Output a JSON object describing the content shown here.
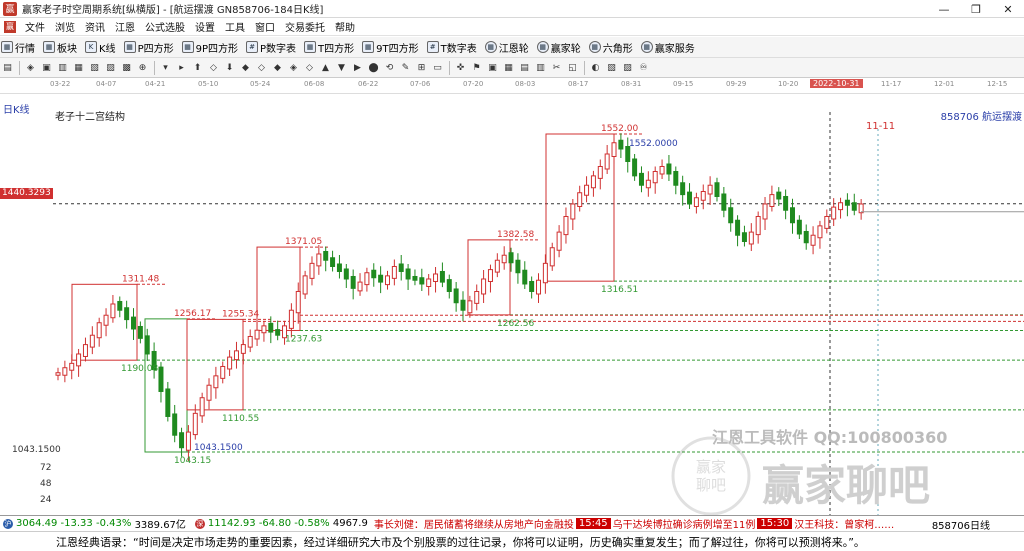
{
  "window": {
    "title": "赢家老子时空周期系统[纵横版] - [航运摆渡  GN858706-184日K线]",
    "controls": [
      "—",
      "❐",
      "✕"
    ]
  },
  "menu": {
    "items": [
      "文件",
      "浏览",
      "资讯",
      "江恩",
      "公式选股",
      "设置",
      "工具",
      "窗口",
      "交易委托",
      "帮助"
    ],
    "mdi_controls": [
      "—",
      "❐",
      "✕"
    ]
  },
  "toolbar1": {
    "items": [
      {
        "label": "行情",
        "icon": "market-grid-icon"
      },
      {
        "label": "板块",
        "icon": "sector-icon"
      },
      {
        "label": "K线",
        "icon": "kline-icon"
      },
      {
        "label": "P四方形",
        "icon": "square-icon"
      },
      {
        "label": "9P四方形",
        "icon": "square-icon"
      },
      {
        "label": "P数字表",
        "icon": "table-icon"
      },
      {
        "label": "T四方形",
        "icon": "square-icon"
      },
      {
        "label": "9T四方形",
        "icon": "square-icon"
      },
      {
        "label": "T数字表",
        "icon": "table-icon"
      },
      {
        "label": "江恩轮",
        "icon": "wheel-icon"
      },
      {
        "label": "赢家轮",
        "icon": "wheel-icon"
      },
      {
        "label": "六角形",
        "icon": "hexagon-icon"
      },
      {
        "label": "赢家服务",
        "icon": "service-icon"
      }
    ]
  },
  "toolbar2": {
    "glyphs": [
      "▤",
      "◈",
      "▣",
      "▥",
      "▦",
      "▧",
      "▨",
      "▩",
      "⊕",
      "▾",
      "▸",
      "⬆",
      "◇",
      "⬇",
      "◆",
      "◇",
      "◆",
      "◈",
      "◇",
      "▲",
      "▼",
      "▶",
      "⬤",
      "⟲",
      "✎",
      "⊞",
      "▭",
      "✜",
      "⚑",
      "▣",
      "▦",
      "▤",
      "▥",
      "✂",
      "◱",
      "◐",
      "▧",
      "▨",
      "♾"
    ]
  },
  "datebar": {
    "labels": [
      "03-22",
      "04-07",
      "04-21",
      "05-10",
      "05-24",
      "06-08",
      "06-22",
      "07-06",
      "07-20",
      "08-03",
      "08-17",
      "08-31",
      "09-15",
      "09-29",
      "10-20",
      "11-17",
      "12-01",
      "12-15"
    ],
    "current": "2022-10-31"
  },
  "chart": {
    "period_label": "日K线",
    "study_label": "老子十二宫结构",
    "symbol_label": "858706  航运摆渡",
    "price_tag": "1440.3293",
    "low_axis_label": "1043.1500",
    "volume_axis": [
      "72",
      "48",
      "24"
    ],
    "forecast_label": "11-11",
    "accent_color": "#d03030",
    "support_color": "#339933"
  },
  "chart_data": {
    "type": "candlestick",
    "title": "老子十二宫结构",
    "annotations": [
      {
        "text": "1311.48",
        "kind": "box-high"
      },
      {
        "text": "1190.08",
        "kind": "box-low"
      },
      {
        "text": "1256.17",
        "kind": "box-high"
      },
      {
        "text": "1043.15",
        "kind": "box-low"
      },
      {
        "text": "1043.1500",
        "kind": "extreme-low"
      },
      {
        "text": "1255.34",
        "kind": "box-high"
      },
      {
        "text": "1110.55",
        "kind": "box-low"
      },
      {
        "text": "1371.05",
        "kind": "box-high"
      },
      {
        "text": "1237.63",
        "kind": "box-low"
      },
      {
        "text": "1382.58",
        "kind": "box-high"
      },
      {
        "text": "1262.56",
        "kind": "box-low"
      },
      {
        "text": "1552.00",
        "kind": "box-high"
      },
      {
        "text": "1552.0000",
        "kind": "extreme-high"
      },
      {
        "text": "1316.51",
        "kind": "box-low"
      }
    ],
    "current_price": 1440.3293,
    "period_high": 1552.0,
    "period_low": 1043.15,
    "boxes": [
      {
        "high": 1311.48,
        "low": 1190.08
      },
      {
        "high": 1256.17,
        "low": 1043.15
      },
      {
        "high": 1255.34,
        "low": 1110.55
      },
      {
        "high": 1371.05,
        "low": 1237.63
      },
      {
        "high": 1382.58,
        "low": 1262.56
      },
      {
        "high": 1552.0,
        "low": 1316.51
      }
    ]
  },
  "watermark": {
    "line1": "江恩工具软件  QQ:100800360",
    "line2": "赢家聊吧"
  },
  "statusbar": {
    "index1": {
      "value": "3064.49",
      "change": "-13.33",
      "pct": "-0.43%",
      "amount": "3389.67亿"
    },
    "index2": {
      "value": "11142.93",
      "change": "-64.80",
      "pct": "-0.58%",
      "amount": "4967.9"
    },
    "news": [
      {
        "text": "事长刘健：居民储蓄将继续从房地产向金融投"
      },
      {
        "tag": "15:45",
        "text": "乌干达埃博拉确诊病例增至11例"
      },
      {
        "tag": "15:30",
        "text": "汉王科技：曾家柯……"
      }
    ],
    "symbol_status": "858706日线"
  },
  "quote": {
    "text": "江恩经典语录：“时间是决定市场走势的重要因素，经过详细研究大市及个别股票的过往记录，你将可以证明，历史确实重复发生；而了解过往，你将可以预测将来。”。"
  }
}
